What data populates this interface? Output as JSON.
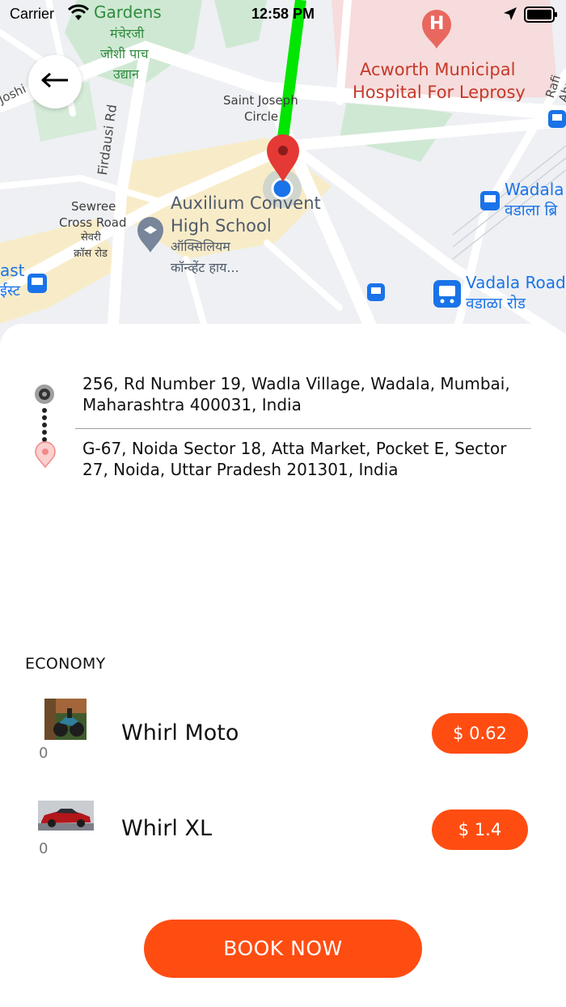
{
  "status_bar": {
    "carrier": "Carrier",
    "time": "12:58 PM"
  },
  "map": {
    "labels": {
      "gardens": "Gardens",
      "gardens_marathi_1": "मंचेरजी",
      "gardens_marathi_2": "जोशी पाच",
      "gardens_marathi_3": "उद्यान",
      "joshi": "Joshi",
      "firdausi": "Firdausi Rd",
      "saint_joseph_1": "Saint Joseph",
      "saint_joseph_2": "Circle",
      "hospital_1": "Acworth Municipal",
      "hospital_2": "Hospital For Leprosy",
      "rafi": "Rafi Ahm",
      "sewree_1": "Sewree",
      "sewree_2": "Cross Road",
      "sewree_3": "सेवरी",
      "sewree_4": "क्रॉस रोड",
      "school_1": "Auxilium Convent",
      "school_2": "High School",
      "school_3": "ऑक्सिलियम",
      "school_4": "कॉन्व्हेंट हाय...",
      "east_1": "ast",
      "east_2": "ईस्ट",
      "wadala_1": "Wadala",
      "wadala_2": "वडाला ब्रि",
      "vadala_1": "Vadala Road",
      "vadala_2": "वडाळा रोड",
      "hospital_marker": "H"
    },
    "icons": [
      "hospital-marker-icon",
      "school-marker-icon",
      "bus-stop-icon",
      "train-station-icon",
      "destination-pin-icon",
      "current-location-icon"
    ],
    "route_color": "#00e600"
  },
  "back_button": {
    "icon": "arrow-left-icon",
    "glyph": "←"
  },
  "trip": {
    "pickup": "256, Rd Number 19, Wadla Village, Wadala, Mumbai, Maharashtra 400031, India",
    "drop": "G-67, Noida Sector 18, Atta Market, Pocket E, Sector 27, Noida, Uttar Pradesh 201301, India"
  },
  "section_title": "ECONOMY",
  "rides": [
    {
      "name": "Whirl Moto",
      "count": "0",
      "price": "$ 0.62",
      "image": "motorbike-photo"
    },
    {
      "name": "Whirl XL",
      "count": "0",
      "price": "$ 1.4",
      "image": "red-car-photo"
    }
  ],
  "book_button": "BOOK NOW",
  "colors": {
    "accent": "#ff4d12",
    "route": "#00e600",
    "map_pin": "#e53935",
    "map_blue": "#1a73e8"
  }
}
